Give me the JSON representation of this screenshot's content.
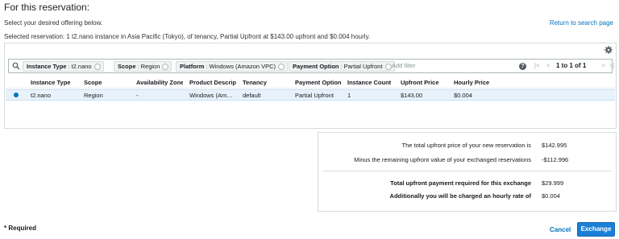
{
  "header": {
    "title": "For this reservation:",
    "subtitle": "Select your desired offering below.",
    "return_link": "Return to search page",
    "selected_reservation": "Selected reservation: 1 t2.nano instance in Asia Pacific (Tokyo), of tenancy, Partial Upfront at $143.00 upfront and $0.004 hourly."
  },
  "filters": {
    "chips": [
      {
        "key": "Instance Type",
        "value": "t2.nano"
      },
      {
        "key": "Scope",
        "value": "Region"
      },
      {
        "key": "Platform",
        "value": "Windows (Amazon VPC)"
      },
      {
        "key": "Payment Option",
        "value": "Partial Upfront"
      }
    ],
    "separator": ":",
    "placeholder": "Add filter",
    "help_glyph": "?"
  },
  "pagination": {
    "first": "|<",
    "prev": "<",
    "range": "1 to 1 of 1",
    "next": ">",
    "last": ">|"
  },
  "table": {
    "columns": [
      "Instance Type",
      "Scope",
      "Availability Zone",
      "Product Description",
      "Tenancy",
      "Payment Option",
      "Instance Count",
      "Upfront Price",
      "Hourly Price"
    ],
    "rows": [
      {
        "cells": [
          "t2.nano",
          "Region",
          "-",
          "Windows (Amazon VPC)",
          "default",
          "Partial Upfront",
          "1",
          "$143.00",
          "$0.004"
        ],
        "selected": true
      }
    ]
  },
  "summary": {
    "rows": [
      {
        "label": "The total upfront price of your new reservation is",
        "value": "$142.995"
      },
      {
        "label": "Minus the remaining upfront value of your exchanged reservations",
        "value": "-$112.996"
      },
      {
        "label": "Total upfront payment required for this exchange",
        "value": "$29.999"
      },
      {
        "label": "Additionally you will be charged an hourly rate of",
        "value": "$0.004"
      }
    ]
  },
  "footer": {
    "required_note": "* Required",
    "cancel_label": "Cancel",
    "exchange_label": "Exchange"
  },
  "colors": {
    "link": "#0073bb",
    "primary_button": "#1a7fd6",
    "selected_row": "#e8f2fb"
  }
}
